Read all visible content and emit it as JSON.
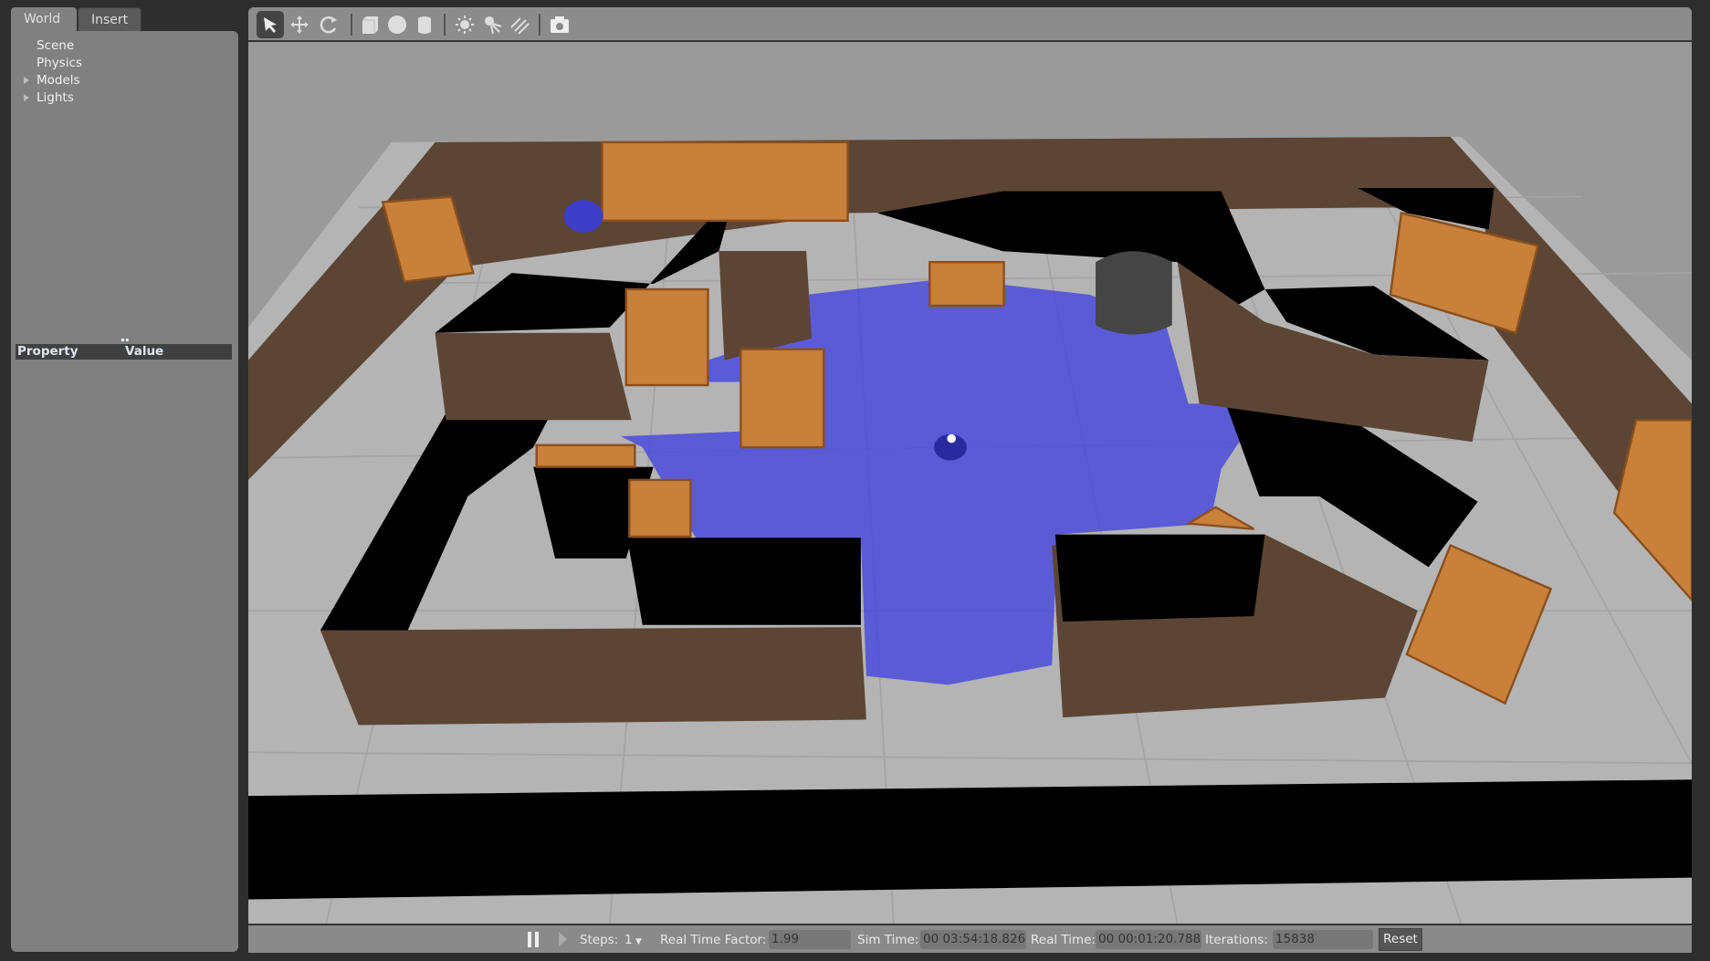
{
  "left_panel": {
    "tabs": [
      "World",
      "Insert"
    ],
    "tree": [
      {
        "label": "Scene",
        "expandable": false
      },
      {
        "label": "Physics",
        "expandable": false
      },
      {
        "label": "Models",
        "expandable": true
      },
      {
        "label": "Lights",
        "expandable": true
      }
    ],
    "property_header": "Property",
    "value_header": "Value"
  },
  "toolbar": {
    "icons": [
      "select-arrow-icon",
      "translate-icon",
      "rotate-icon",
      "box-icon",
      "sphere-icon",
      "cylinder-icon",
      "point-light-icon",
      "spot-light-icon",
      "directional-light-icon",
      "screenshot-icon"
    ]
  },
  "bottom_bar": {
    "steps_label": "Steps:",
    "steps_value": "1",
    "rtf_label": "Real Time Factor:",
    "rtf_value": "1.99",
    "sim_label": "Sim Time:",
    "sim_value": "00 03:54:18.826",
    "real_label": "Real Time:",
    "real_value": "00 00:01:20.788",
    "iter_label": "Iterations:",
    "iter_value": "15838",
    "reset_label": "Reset"
  },
  "colors": {
    "floor": "#b5b5b5",
    "wall": "#5c4535",
    "wall_top": "#000000",
    "laser": "#4b4bdc",
    "shelf": "#c8803a"
  }
}
